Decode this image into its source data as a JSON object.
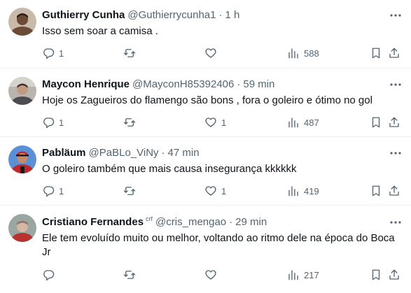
{
  "tweets": [
    {
      "name": "Guthierry Cunha",
      "badge": "",
      "handle": "@Guthierrycunha1",
      "separator": "·",
      "time": "1 h",
      "text": "Isso sem soar a camisa .",
      "replies": "1",
      "retweets": "",
      "likes": "",
      "views": "588",
      "avatar_colors": {
        "bg": "#c9b9a8",
        "skin": "#6b4a36",
        "hair": "#2a1c14"
      }
    },
    {
      "name": "Maycon Henrique",
      "badge": "",
      "handle": "@MayconH85392406",
      "separator": "·",
      "time": "59 min",
      "text": "Hoje os Zagueiros do flamengo são bons , fora o goleiro e ótimo no gol",
      "replies": "1",
      "retweets": "",
      "likes": "1",
      "views": "487",
      "avatar_colors": {
        "bg": "#b9b4ad",
        "skin": "#c29a82",
        "hair": "#3a2f2a"
      }
    },
    {
      "name": "Pabläum",
      "badge": "",
      "handle": "@PaBLo_ViNy",
      "separator": "·",
      "time": "47 min",
      "text": "O goleiro também que mais causa insegurança kkkkkk",
      "replies": "1",
      "retweets": "",
      "likes": "1",
      "views": "419",
      "avatar_colors": {
        "bg": "#5b8fd6",
        "skin": "#c28c6a",
        "hair": "#c0262b"
      }
    },
    {
      "name": "Cristiano Fernandes",
      "badge": "crf",
      "handle": "@cris_mengao",
      "separator": "·",
      "time": "29 min",
      "text": "Ele tem evoluído muito ou melhor, voltando ao ritmo dele na época do Boca Jr",
      "replies": "",
      "retweets": "",
      "likes": "",
      "views": "217",
      "avatar_colors": {
        "bg": "#9aa6a0",
        "skin": "#d5b7a3",
        "hair": "#b8322f"
      }
    }
  ],
  "icons": {
    "reply": "reply-icon",
    "retweet": "retweet-icon",
    "like": "heart-icon",
    "views": "views-icon",
    "bookmark": "bookmark-icon",
    "share": "share-icon",
    "more": "more-icon"
  },
  "colors": {
    "text": "#0f1419",
    "secondary": "#536471",
    "divider": "#eff3f4"
  }
}
